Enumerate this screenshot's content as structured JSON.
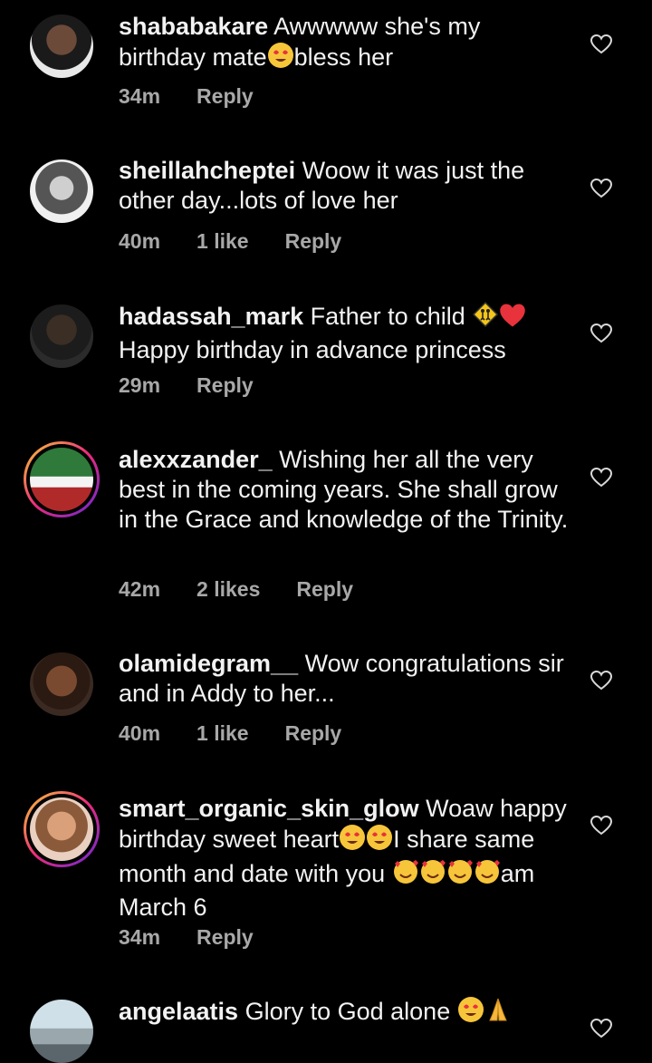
{
  "comments": [
    {
      "username": "shababakare",
      "text": "Awwwww she's my birthday mate",
      "text_after": "bless her",
      "time": "34m",
      "likes": "",
      "reply": "Reply"
    },
    {
      "username": "sheillahcheptei",
      "text": "Woow it was just the other day...lots of love her",
      "time": "40m",
      "likes": "1 like",
      "reply": "Reply"
    },
    {
      "username": "hadassah_mark",
      "text": "Father to child",
      "text_line2": "Happy birthday in advance princess",
      "time": "29m",
      "likes": "",
      "reply": "Reply"
    },
    {
      "username": "alexxzander_",
      "text": "Wishing her all the very best in the coming years.  She shall grow in the Grace and knowledge  of the  Trinity.",
      "time": "42m",
      "likes": "2 likes",
      "reply": "Reply"
    },
    {
      "username": "olamidegram__",
      "text": "Wow congratulations sir and in Addy to her...",
      "time": "40m",
      "likes": "1 like",
      "reply": "Reply"
    },
    {
      "username": "smart_organic_skin_glow",
      "text": "Woaw happy birthday sweet heart",
      "text_mid": "I share same month and date with you",
      "text_end": "am March 6",
      "time": "34m",
      "likes": "",
      "reply": "Reply"
    },
    {
      "username": "angelaatis",
      "text": "Glory to God alone",
      "time": "",
      "likes": "",
      "reply": ""
    }
  ],
  "colors": {
    "background": "#000000",
    "text": "#f2f2f2",
    "meta": "#a8a8a8",
    "ring": "#ee2a7b"
  }
}
